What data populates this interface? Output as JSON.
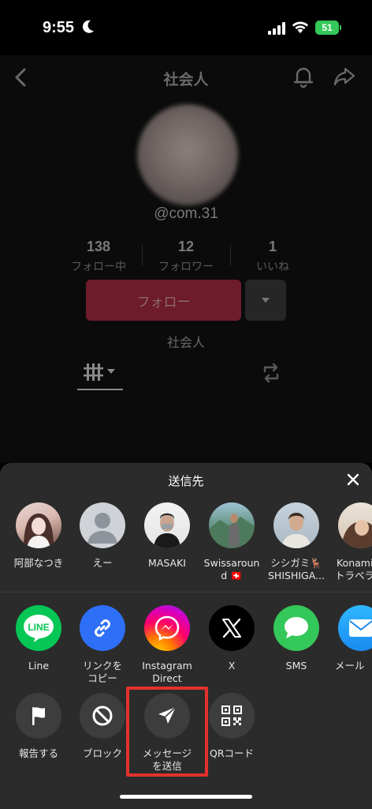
{
  "status_bar": {
    "time": "9:55",
    "battery": "51"
  },
  "profile": {
    "title": "社会人",
    "username": "@com.31",
    "stats": [
      {
        "value": "138",
        "label": "フォロー中"
      },
      {
        "value": "12",
        "label": "フォロワー"
      },
      {
        "value": "1",
        "label": "いいね"
      }
    ],
    "follow_label": "フォロー",
    "bio": "社会人"
  },
  "share_sheet": {
    "title": "送信先",
    "contacts": [
      {
        "name": "阿部なつき"
      },
      {
        "name": "えー"
      },
      {
        "name": "MASAKI"
      },
      {
        "name_line1": "Swissaroun",
        "name_line2": "d 🇨🇭"
      },
      {
        "name_line1": "シシガミ🦌",
        "name_line2": "SHISHIGA..."
      },
      {
        "name_line1": "Konami",
        "name_line2": "トラベラ"
      }
    ],
    "apps": [
      {
        "label": "Line",
        "icon": "line-icon",
        "color": "#06c755"
      },
      {
        "label_line1": "リンクを",
        "label_line2": "コピー",
        "icon": "link-icon",
        "color": "#2d6ff7"
      },
      {
        "label_line1": "Instagram",
        "label_line2": "Direct",
        "icon": "messenger-icon",
        "color": "#c13584"
      },
      {
        "label": "X",
        "icon": "x-icon",
        "color": "#000000"
      },
      {
        "label": "SMS",
        "icon": "sms-icon",
        "color": "#34c759"
      },
      {
        "label": "メール",
        "icon": "mail-icon",
        "color": "#1da1f2"
      }
    ],
    "actions": [
      {
        "label": "報告する",
        "icon": "flag-icon"
      },
      {
        "label": "ブロック",
        "icon": "block-icon"
      },
      {
        "label_line1": "メッセージ",
        "label_line2": "を送信",
        "icon": "send-icon"
      },
      {
        "label": "QRコード",
        "icon": "qr-code-icon"
      }
    ]
  }
}
